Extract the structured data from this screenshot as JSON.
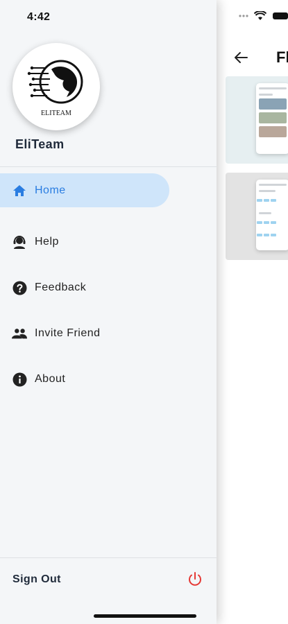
{
  "status": {
    "time": "4:42"
  },
  "brand": {
    "name": "EliTeam",
    "logo_text": "ELITEAM"
  },
  "menu": {
    "items": [
      {
        "label": "Home",
        "icon": "home-icon",
        "active": true
      },
      {
        "label": "Help",
        "icon": "support-agent-icon",
        "active": false
      },
      {
        "label": "Feedback",
        "icon": "question-circle-icon",
        "active": false
      },
      {
        "label": "Invite Friend",
        "icon": "people-icon",
        "active": false
      },
      {
        "label": "About",
        "icon": "info-icon",
        "active": false
      }
    ]
  },
  "signout": {
    "label": "Sign Out",
    "icon": "power-icon"
  },
  "behind": {
    "title": "Fl"
  },
  "colors": {
    "accent": "#2a7de1",
    "active_bg": "#cfe5fa",
    "power": "#e53935",
    "drawer_bg": "#f4f6f8"
  }
}
